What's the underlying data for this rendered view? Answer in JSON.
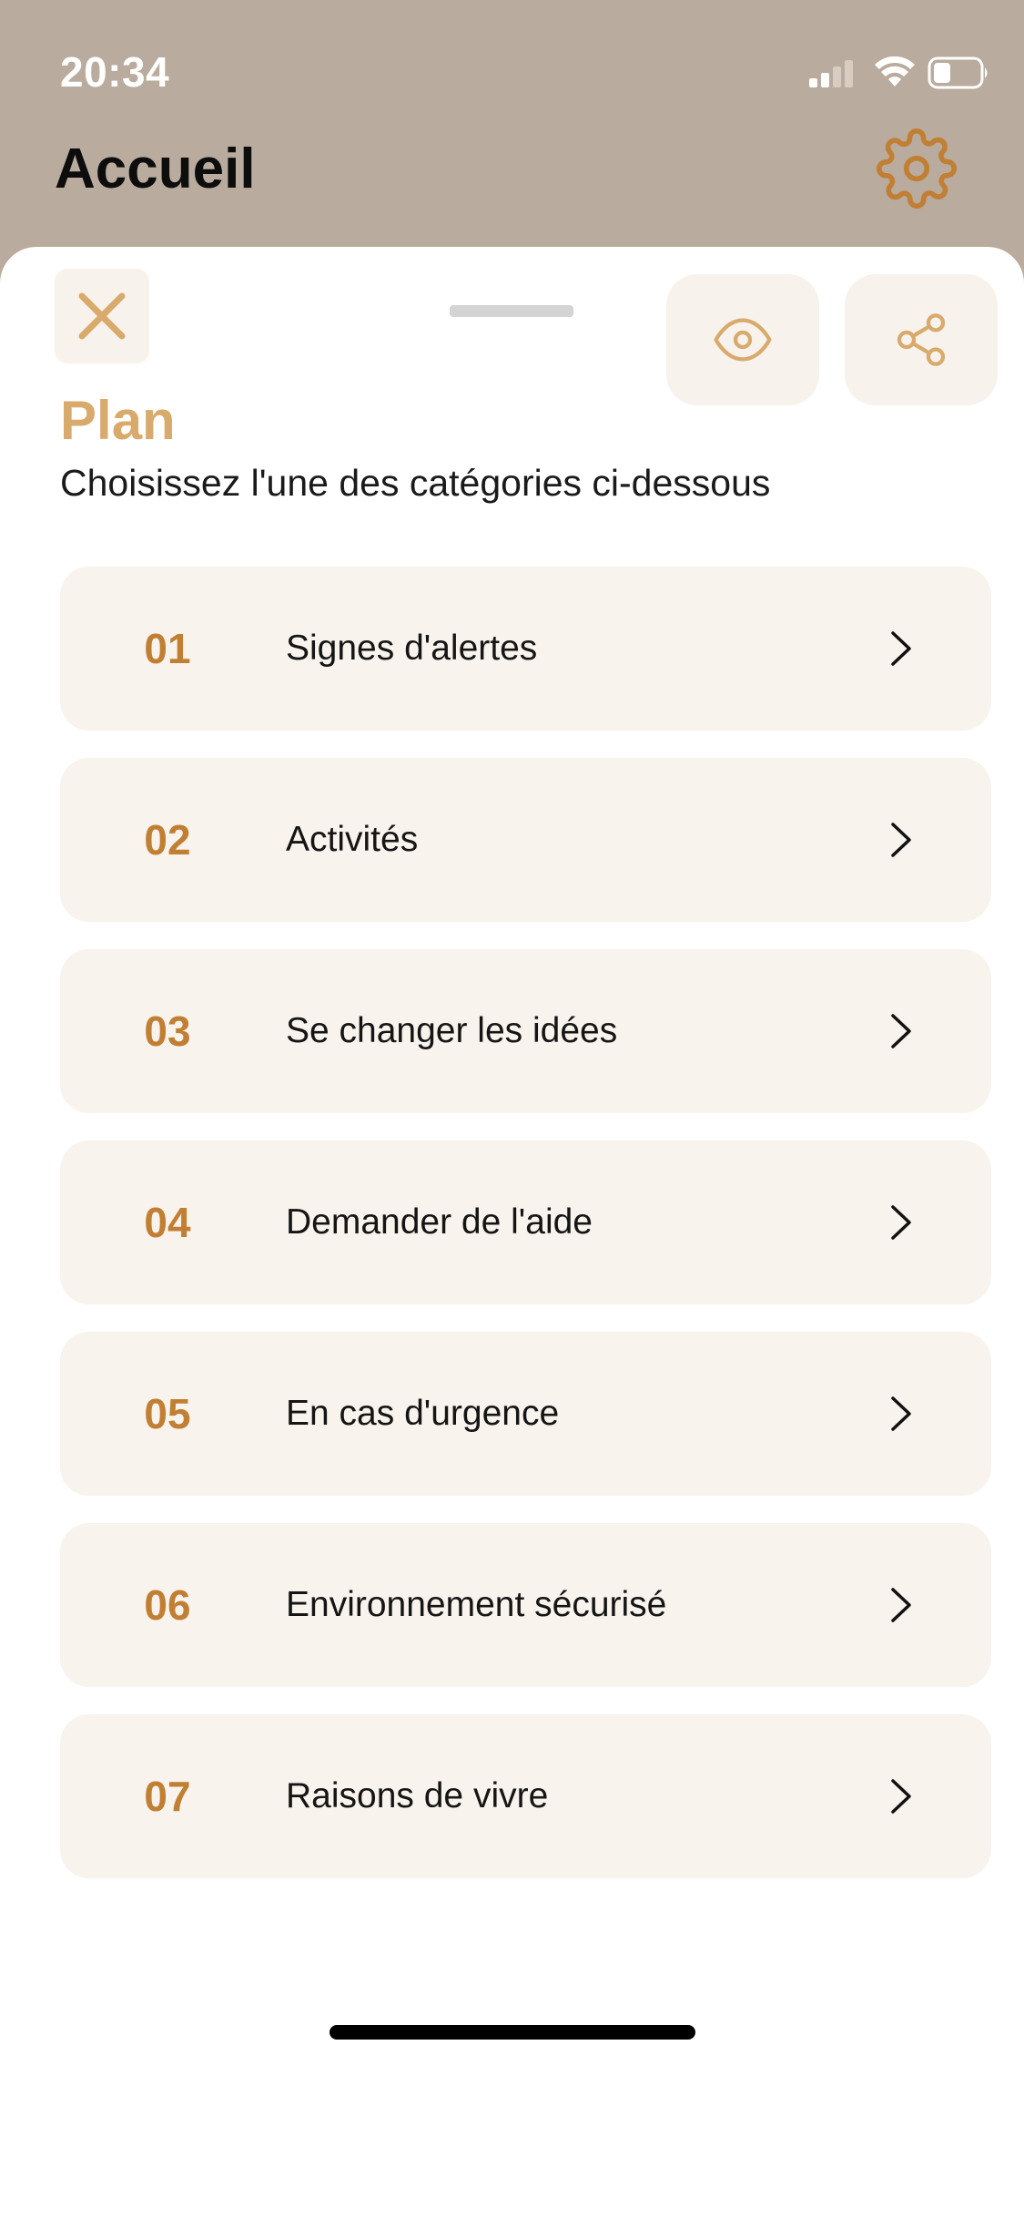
{
  "status_bar": {
    "time": "20:34",
    "icons": [
      "signal-icon",
      "wifi-icon",
      "battery-icon"
    ]
  },
  "header": {
    "title": "Accueil",
    "settings_icon": "gear-icon"
  },
  "sheet": {
    "close_icon": "close-icon",
    "view_icon": "eye-icon",
    "share_icon": "share-icon",
    "title": "Plan",
    "subtitle": "Choisissez l'une des catégories ci-dessous",
    "categories": [
      {
        "number": "01",
        "label": "Signes d'alertes"
      },
      {
        "number": "02",
        "label": "Activités"
      },
      {
        "number": "03",
        "label": "Se changer les idées"
      },
      {
        "number": "04",
        "label": "Demander de l'aide"
      },
      {
        "number": "05",
        "label": "En cas d'urgence"
      },
      {
        "number": "06",
        "label": "Environnement sécurisé"
      },
      {
        "number": "07",
        "label": "Raisons de vivre"
      }
    ]
  },
  "colors": {
    "header_background": "#b9ab9d",
    "accent": "#d8aa6c",
    "number": "#c17f33",
    "card_background": "#f8f3ed"
  }
}
